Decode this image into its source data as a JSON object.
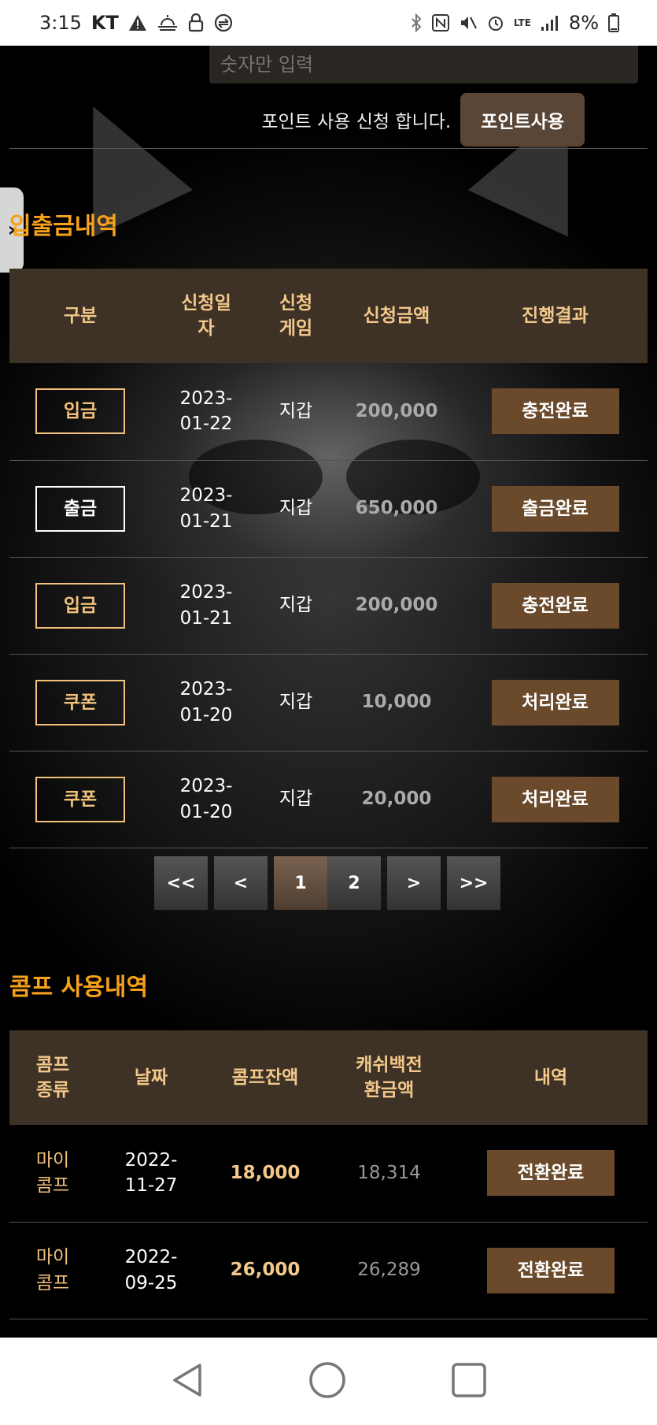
{
  "status_bar": {
    "time": "3:15",
    "carrier": "KT",
    "battery": "8%",
    "network": "LTE"
  },
  "point": {
    "input_placeholder": "숫자만 입력",
    "request_text": "포인트 사용 신청 합니다.",
    "button_label": "포인트사용"
  },
  "transactions": {
    "title": "입출금내역",
    "headers": [
      "구분",
      "신청일자",
      "신청게임",
      "신청금액",
      "진행결과"
    ],
    "header_lines": {
      "col2_line1": "신청일",
      "col2_line2": "자",
      "col3_line1": "신청",
      "col3_line2": "게임"
    },
    "rows": [
      {
        "type": "입금",
        "style": "gold",
        "date_y": "2023-",
        "date_md": "01-22",
        "game": "지갑",
        "amount": "200,000",
        "result": "충전완료"
      },
      {
        "type": "출금",
        "style": "white",
        "date_y": "2023-",
        "date_md": "01-21",
        "game": "지갑",
        "amount": "650,000",
        "result": "출금완료"
      },
      {
        "type": "입금",
        "style": "gold",
        "date_y": "2023-",
        "date_md": "01-21",
        "game": "지갑",
        "amount": "200,000",
        "result": "충전완료"
      },
      {
        "type": "쿠폰",
        "style": "gold",
        "date_y": "2023-",
        "date_md": "01-20",
        "game": "지갑",
        "amount": "10,000",
        "result": "처리완료"
      },
      {
        "type": "쿠폰",
        "style": "gold",
        "date_y": "2023-",
        "date_md": "01-20",
        "game": "지갑",
        "amount": "20,000",
        "result": "처리완료"
      }
    ]
  },
  "pagination": {
    "first": "<<",
    "prev": "<",
    "pages": [
      "1",
      "2"
    ],
    "current": "1",
    "next": ">",
    "last": ">>"
  },
  "comp": {
    "title": "콤프 사용내역",
    "header_lines": {
      "kind_line1": "콤프",
      "kind_line2": "종류",
      "date": "날짜",
      "balance": "콤프잔액",
      "cash_line1": "캐쉬백전",
      "cash_line2": "환금액",
      "detail": "내역"
    },
    "rows": [
      {
        "kind_line1": "마이",
        "kind_line2": "콤프",
        "date_y": "2022-",
        "date_md": "11-27",
        "balance": "18,000",
        "cash": "18,314",
        "result": "전환완료"
      },
      {
        "kind_line1": "마이",
        "kind_line2": "콤프",
        "date_y": "2022-",
        "date_md": "09-25",
        "balance": "26,000",
        "cash": "26,289",
        "result": "전환완료"
      }
    ]
  }
}
